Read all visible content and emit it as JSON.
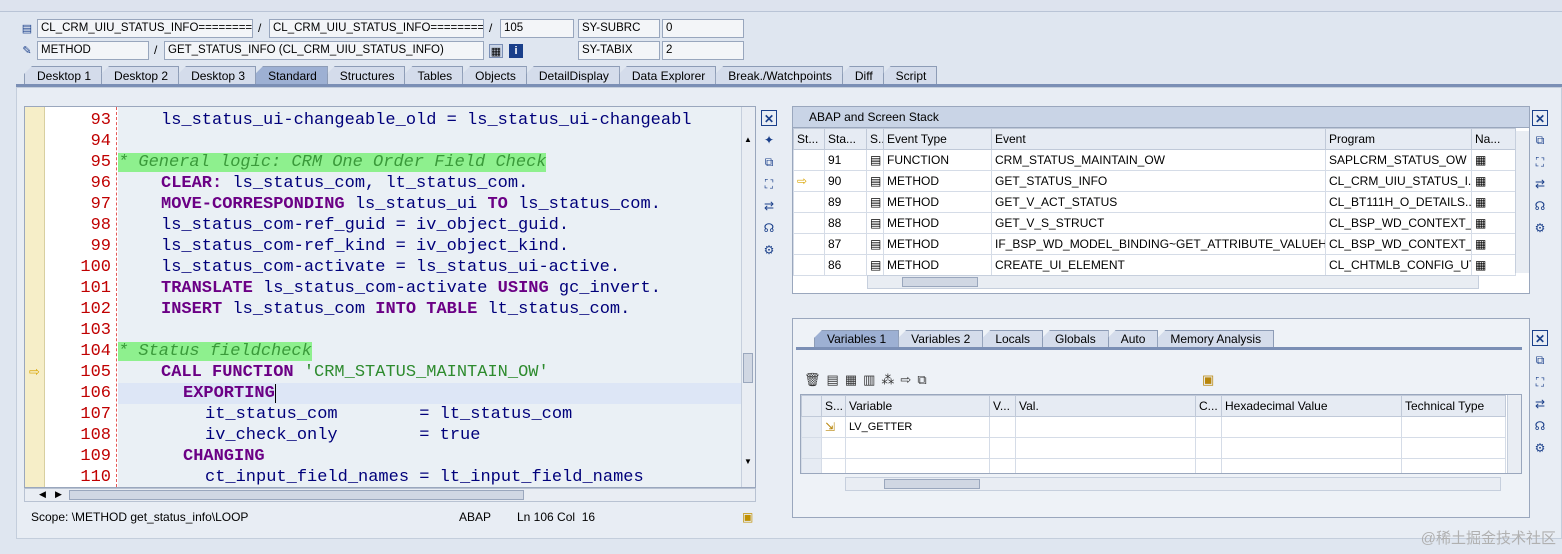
{
  "header": {
    "row1": {
      "class1": "CL_CRM_UIU_STATUS_INFO=========",
      "class2": "CL_CRM_UIU_STATUS_INFO=========",
      "line": "105",
      "sysvar": "SY-SUBRC",
      "sysval": "0"
    },
    "row2": {
      "type": "METHOD",
      "name": "GET_STATUS_INFO (CL_CRM_UIU_STATUS_INFO)",
      "sysvar": "SY-TABIX",
      "sysval": "2"
    }
  },
  "tabs": [
    "Desktop 1",
    "Desktop 2",
    "Desktop 3",
    "Standard",
    "Structures",
    "Tables",
    "Objects",
    "DetailDisplay",
    "Data Explorer",
    "Break./Watchpoints",
    "Diff",
    "Script"
  ],
  "active_tab": "Standard",
  "code": {
    "line_numbers": [
      "93",
      "94",
      "95",
      "96",
      "97",
      "98",
      "99",
      "100",
      "101",
      "102",
      "103",
      "104",
      "105",
      "106",
      "107",
      "108",
      "109",
      "110"
    ],
    "lines": {
      "l93": "ls_status_ui-changeable_old = ls_status_ui-changeabl",
      "l95": "* General logic: CRM One Order Field Check",
      "l96a": "CLEAR:",
      "l96b": " ls_status_com, lt_status_com.",
      "l97a": "MOVE-CORRESPONDING",
      "l97b": " ls_status_ui ",
      "l97c": "TO",
      "l97d": " ls_status_com.",
      "l98": "ls_status_com-ref_guid = iv_object_guid.",
      "l99": "ls_status_com-ref_kind = iv_object_kind.",
      "l100": "ls_status_com-activate = ls_status_ui-active.",
      "l101a": "TRANSLATE",
      "l101b": " ls_status_com-activate ",
      "l101c": "USING",
      "l101d": " gc_invert.",
      "l102a": "INSERT",
      "l102b": " ls_status_com ",
      "l102c": "INTO TABLE",
      "l102d": " lt_status_com.",
      "l104": "* Status fieldcheck",
      "l105a": "CALL FUNCTION",
      "l105b": "'CRM_STATUS_MAINTAIN_OW'",
      "l106": "EXPORTING",
      "l107": "it_status_com        = lt_status_com",
      "l108": "iv_check_only        = true",
      "l109": "CHANGING",
      "l110": "ct_input_field_names = lt_input_field_names"
    }
  },
  "editor_status": {
    "scope": "Scope: \\METHOD get_status_info\\LOOP",
    "lang": "ABAP",
    "position": "Ln 106 Col  16"
  },
  "stack": {
    "title": "ABAP and Screen Stack",
    "columns": [
      "St...",
      "Sta...",
      "S...",
      "Event Type",
      "Event",
      "Program",
      "Na..."
    ],
    "rows": [
      {
        "level": "91",
        "type": "FUNCTION",
        "event": "CRM_STATUS_MAINTAIN_OW",
        "program": "SAPLCRM_STATUS_OW"
      },
      {
        "level": "90",
        "type": "METHOD",
        "event": "GET_STATUS_INFO",
        "program": "CL_CRM_UIU_STATUS_I..."
      },
      {
        "level": "89",
        "type": "METHOD",
        "event": "GET_V_ACT_STATUS",
        "program": "CL_BT111H_O_DETAILS..."
      },
      {
        "level": "88",
        "type": "METHOD",
        "event": "GET_V_S_STRUCT",
        "program": "CL_BSP_WD_CONTEXT_..."
      },
      {
        "level": "87",
        "type": "METHOD",
        "event": "IF_BSP_WD_MODEL_BINDING~GET_ATTRIBUTE_VALUEH...",
        "program": "CL_BSP_WD_CONTEXT_..."
      },
      {
        "level": "86",
        "type": "METHOD",
        "event": "CREATE_UI_ELEMENT",
        "program": "CL_CHTMLB_CONFIG_UT..."
      }
    ]
  },
  "var_tabs": [
    "Variables 1",
    "Variables 2",
    "Locals",
    "Globals",
    "Auto",
    "Memory Analysis"
  ],
  "variables": {
    "columns": [
      "S...",
      "Variable",
      "V...",
      "Val.",
      "C...",
      "Hexadecimal Value",
      "Technical Type"
    ],
    "rows": [
      {
        "name": "LV_GETTER"
      }
    ]
  },
  "watermark": "@稀土掘金技术社区",
  "colors": {
    "tab_active": "#9db0d3",
    "comment_bg": "#8ef08e",
    "keyword": "#6b0085",
    "linenum": "#c00000"
  }
}
